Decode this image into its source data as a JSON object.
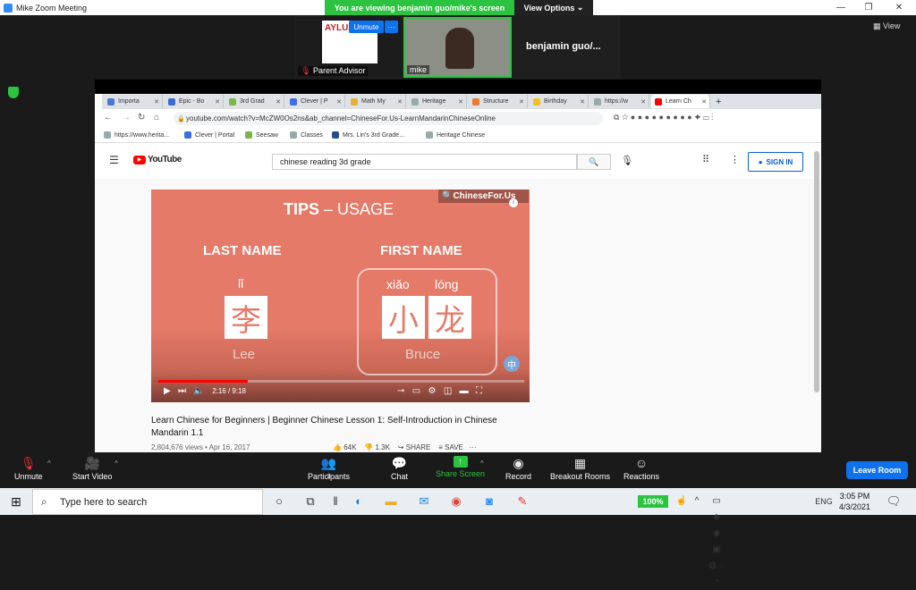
{
  "window": {
    "title": "Mike  Zoom Meeting"
  },
  "banner": {
    "text": "You are viewing benjamin guo/mike's screen",
    "view_options": "View Options"
  },
  "participants": {
    "tile1_name": "Parent Advisor",
    "tile1_logo": "AYLUS",
    "tile2_name": "mike",
    "big_name": "benjamin  guo/...",
    "unmute": "Unmute",
    "more": "···"
  },
  "view_label": "View",
  "browser": {
    "tabs": [
      {
        "label": "Importa",
        "color": "#4a78d4"
      },
      {
        "label": "Epic - Bo",
        "color": "#3a6bd0"
      },
      {
        "label": "3rd Grad",
        "color": "#7ab648"
      },
      {
        "label": "Clever | P",
        "color": "#3b6fde"
      },
      {
        "label": "Math My",
        "color": "#e8b030"
      },
      {
        "label": "Heritage",
        "color": "#9aa"
      },
      {
        "label": "Structure",
        "color": "#e87b30"
      },
      {
        "label": "Birthday",
        "color": "#f0c020"
      },
      {
        "label": "https://w",
        "color": "#9aa"
      },
      {
        "label": "Learn Ch",
        "color": "#ff0000"
      }
    ],
    "url": "youtube.com/watch?v=McZW0Os2ns&ab_channel=ChineseFor.Us-LearnMandarinChineseOnline",
    "bookmarks": [
      {
        "label": "https://www.herita...",
        "color": "#9aa"
      },
      {
        "label": "Clever | Portal",
        "color": "#3b6fde"
      },
      {
        "label": "Seesaw",
        "color": "#7ab648"
      },
      {
        "label": "Classes",
        "color": "#9aa"
      },
      {
        "label": "Mrs. Lin's 3rd Grade...",
        "color": "#2a4d8f"
      },
      {
        "label": "Heritage Chinese",
        "color": "#9aa"
      }
    ]
  },
  "youtube": {
    "logo": "YouTube",
    "search_value": "chinese reading 3d grade",
    "signin": "SIGN IN",
    "video": {
      "title_a": "TIPS",
      "title_b": " – USAGE",
      "brand": "ChineseFor.Us",
      "last_name_label": "LAST NAME",
      "first_name_label": "FIRST NAME",
      "pinyin_last": "lǐ",
      "pinyin_first_1": "xiǎo",
      "pinyin_first_2": "lóng",
      "char_last": "李",
      "char_first_1": "小",
      "char_first_2": "龙",
      "english_last": "Lee",
      "english_first": "Bruce",
      "badge": "中",
      "time": "2:16 / 9:18",
      "progress": 0.245
    },
    "video_title": "Learn Chinese for Beginners | Beginner Chinese Lesson 1: Self-Introduction in Chinese Mandarin 1.1",
    "video_meta": "2,804,676 views • Apr 16, 2017",
    "likes": "64K",
    "dislikes": "1.3K",
    "share": "SHARE",
    "save": "SAVE"
  },
  "toolbar": {
    "unmute": "Unmute",
    "start_video": "Start Video",
    "participants": "Participants",
    "participants_count": "3",
    "chat": "Chat",
    "share_screen": "Share Screen",
    "record": "Record",
    "breakout": "Breakout Rooms",
    "reactions": "Reactions",
    "leave": "Leave Room"
  },
  "taskbar": {
    "search_placeholder": "Type here to search",
    "battery": "100%",
    "language": "ENG",
    "time": "3:05 PM",
    "date": "4/3/2021"
  }
}
